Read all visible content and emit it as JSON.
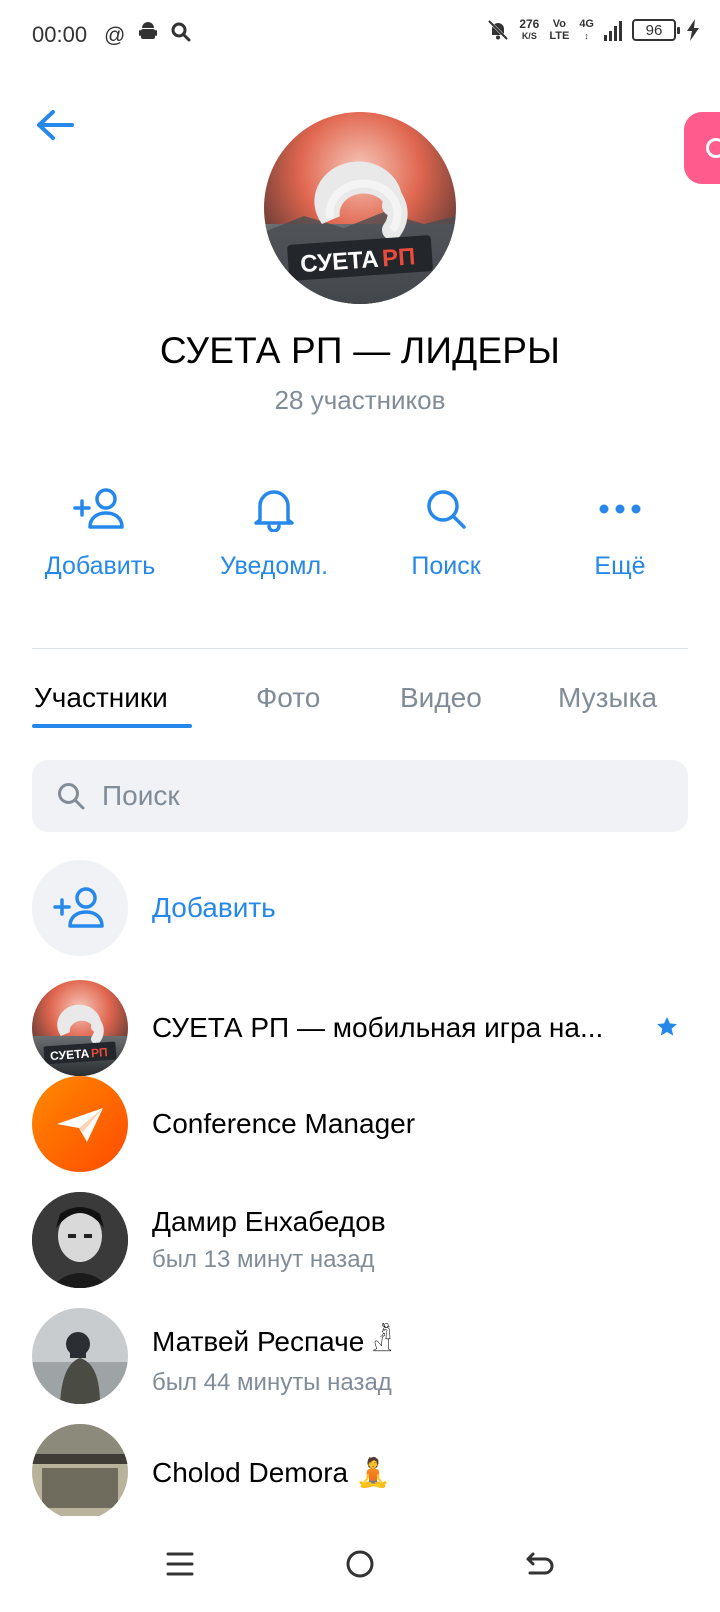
{
  "status_bar": {
    "time": "00:00",
    "left_icons": [
      "at-icon",
      "android-icon",
      "search-icon"
    ],
    "speed_value": "276",
    "speed_unit": "K/S",
    "volte_top": "Vo",
    "volte_bottom": "LTE",
    "network": "4G",
    "battery": "96"
  },
  "header": {
    "title": "СУЕТА РП — ЛИДЕРЫ",
    "subtitle": "28 участников",
    "avatar_text_main": "СУЕТА",
    "avatar_text_accent": "РП"
  },
  "actions": [
    {
      "label": "Добавить",
      "icon": "add-user-icon"
    },
    {
      "label": "Уведомл.",
      "icon": "bell-icon"
    },
    {
      "label": "Поиск",
      "icon": "search-icon"
    },
    {
      "label": "Ещё",
      "icon": "more-icon"
    }
  ],
  "tabs": [
    {
      "label": "Участники",
      "active": true
    },
    {
      "label": "Фото",
      "active": false
    },
    {
      "label": "Видео",
      "active": false
    },
    {
      "label": "Музыка",
      "active": false
    }
  ],
  "search": {
    "placeholder": "Поиск"
  },
  "add_member": {
    "label": "Добавить"
  },
  "members": [
    {
      "name": "СУЕТА РП — мобильная игра на...",
      "status": "",
      "avatar": "group-logo",
      "verified": true
    },
    {
      "name": "Conference Manager",
      "status": "",
      "avatar": "paper-plane",
      "verified": false
    },
    {
      "name": "Дамир Енхабедов",
      "status": "был 13 минут назад",
      "avatar": "photo",
      "verified": false
    },
    {
      "name": "Матвей Респаче",
      "emoji": "𓁚",
      "status": "был 44 минуты назад",
      "avatar": "photo",
      "verified": false
    },
    {
      "name": "Cholod Demora",
      "emoji": "🧘",
      "status": "",
      "avatar": "photo",
      "verified": false
    }
  ],
  "colors": {
    "accent": "#2688eb",
    "secondary_text": "#818c99",
    "pink_pill": "#ff5c8d",
    "orange": "#ff6a00"
  }
}
